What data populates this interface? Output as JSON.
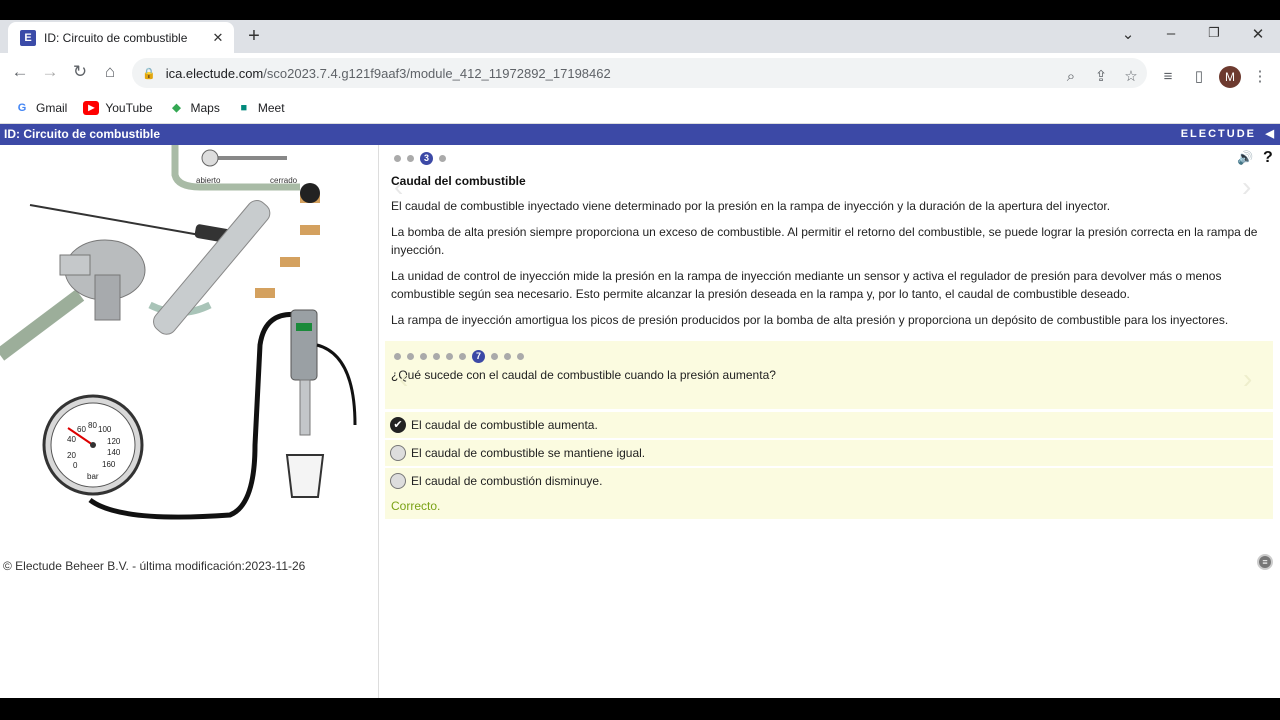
{
  "browser": {
    "tab_title": "ID: Circuito de combustible",
    "tab_favicon": "E",
    "url_host": "ica.electude.com",
    "url_path": "/sco2023.7.4.g121f9aaf3/module_412_11972892_17198462",
    "avatar_letter": "M",
    "bookmarks": [
      {
        "label": "Gmail",
        "icon": "G"
      },
      {
        "label": "YouTube",
        "icon": "▶"
      },
      {
        "label": "Maps",
        "icon": "◆"
      },
      {
        "label": "Meet",
        "icon": "■"
      }
    ]
  },
  "app": {
    "header_title": "ID: Circuito de combustible",
    "brand": "ELECTUDE",
    "valve_open_label": "abierto",
    "valve_closed_label": "cerrado",
    "gauge_unit": "bar",
    "gauge_ticks": [
      "20",
      "40",
      "60",
      "80",
      "100",
      "120",
      "140",
      "160",
      "0"
    ],
    "copyright": "© Electude Beheer B.V. - última modificación:2023-11-26"
  },
  "content": {
    "page_indicator": "3",
    "title": "Caudal del combustible",
    "paragraphs": [
      "El caudal de combustible inyectado viene determinado por la presión en la rampa de inyección y la duración de la apertura del inyector.",
      "La bomba de alta presión siempre proporciona un exceso de combustible. Al permitir el retorno del combustible, se puede lograr la presión correcta en la rampa de inyección.",
      "La unidad de control de inyección mide la presión en la rampa de inyección mediante un sensor y activa el regulador de presión para devolver más o menos combustible según sea necesario. Esto permite alcanzar la presión deseada en la rampa y, por lo tanto, el caudal de combustible deseado.",
      "La rampa de inyección amortigua los picos de presión producidos por la bomba de alta presión y proporciona un depósito de combustible para los inyectores."
    ]
  },
  "quiz": {
    "question_indicator": "7",
    "question": "¿Qué sucede con el caudal de combustible cuando la presión aumenta?",
    "options": [
      {
        "label": "El caudal de combustible aumenta.",
        "selected": true
      },
      {
        "label": "El caudal de combustible se mantiene igual.",
        "selected": false
      },
      {
        "label": "El caudal de combustión disminuye.",
        "selected": false
      }
    ],
    "feedback": "Correcto."
  },
  "colors": {
    "header_blue": "#3c49a6",
    "quiz_bg": "#fbfbe0",
    "correct_green": "#7aa216"
  }
}
